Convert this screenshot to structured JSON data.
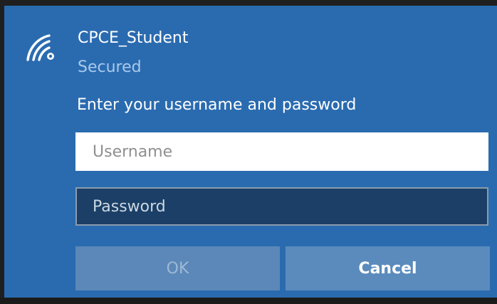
{
  "network": {
    "icon": "wifi-secured-icon",
    "name": "CPCE_Student",
    "status": "Secured"
  },
  "auth": {
    "prompt": "Enter your username and password",
    "username_placeholder": "Username",
    "username_value": "",
    "password_placeholder": "Password",
    "password_value": ""
  },
  "buttons": {
    "ok_label": "OK",
    "cancel_label": "Cancel"
  },
  "colors": {
    "panel_background": "#2a6bb0",
    "secondary_text": "#a9c9ec",
    "button_background": "#5a8bbc",
    "password_field_background": "#1b3f66"
  }
}
